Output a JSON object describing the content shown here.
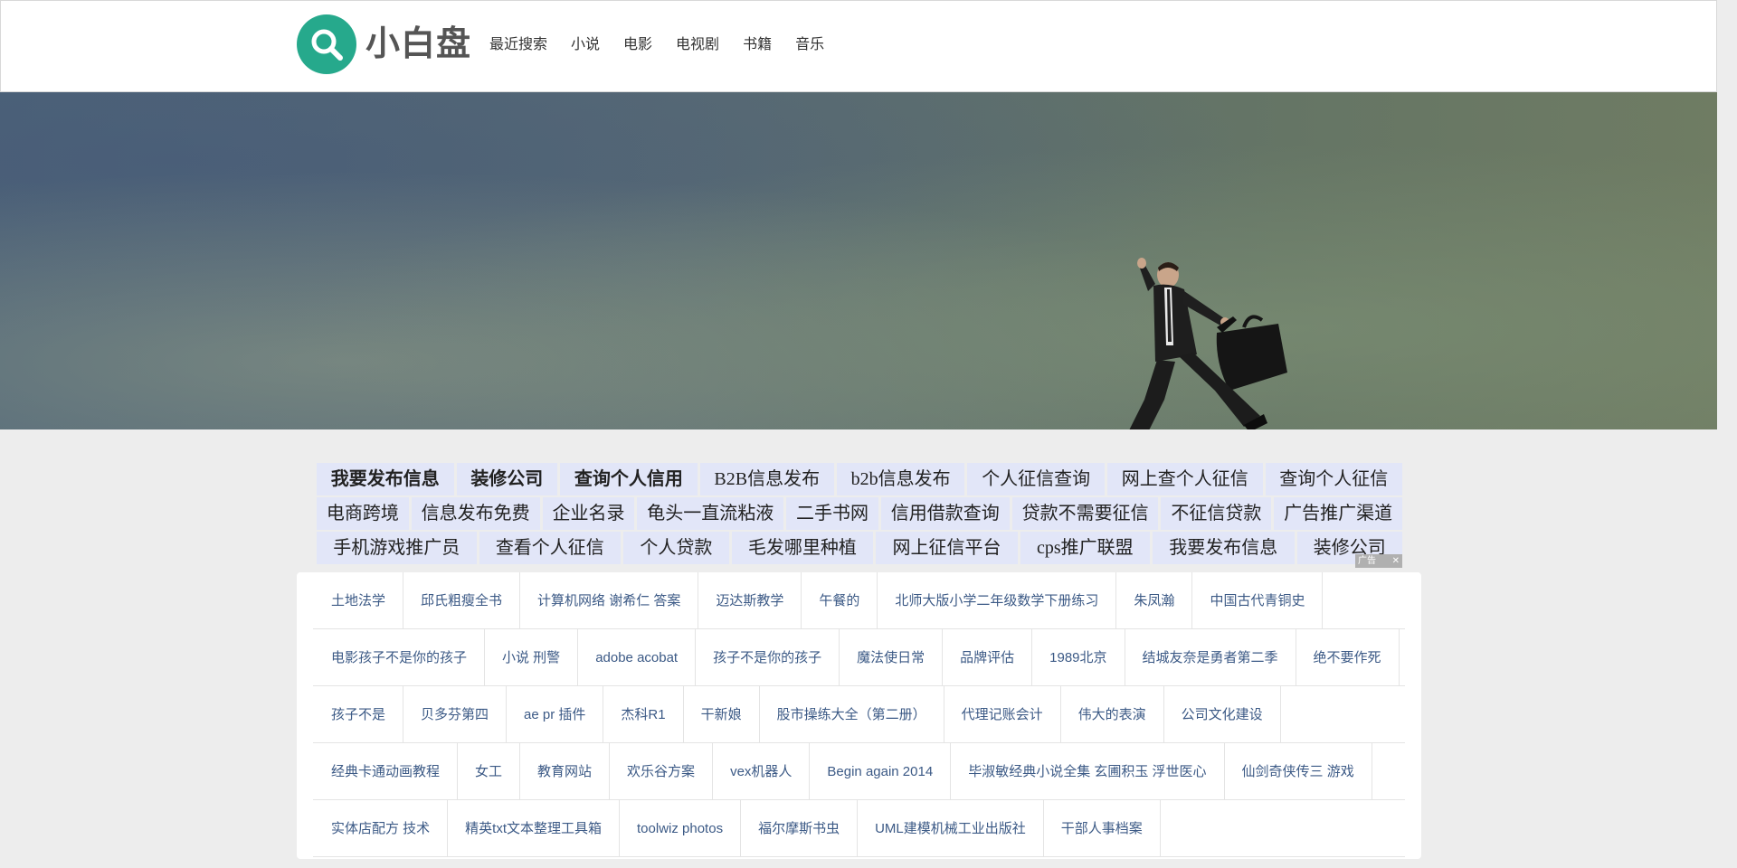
{
  "header": {
    "logo_text": "小白盘",
    "nav": [
      "最近搜索",
      "小说",
      "电影",
      "电视剧",
      "书籍",
      "音乐"
    ]
  },
  "ad": {
    "rows": [
      [
        {
          "text": "我要发布信息",
          "bold": true
        },
        {
          "text": "装修公司",
          "bold": true
        },
        {
          "text": "查询个人信用",
          "bold": true
        },
        {
          "text": "B2B信息发布",
          "bold": false
        },
        {
          "text": "b2b信息发布",
          "bold": false
        },
        {
          "text": "个人征信查询",
          "bold": false
        },
        {
          "text": "网上查个人征信",
          "bold": false
        },
        {
          "text": "查询个人征信",
          "bold": false
        }
      ],
      [
        {
          "text": "电商跨境",
          "bold": false
        },
        {
          "text": "信息发布免费",
          "bold": false
        },
        {
          "text": "企业名录",
          "bold": false
        },
        {
          "text": "龟头一直流粘液",
          "bold": false
        },
        {
          "text": "二手书网",
          "bold": false
        },
        {
          "text": "信用借款查询",
          "bold": false
        },
        {
          "text": "贷款不需要征信",
          "bold": false
        },
        {
          "text": "不征信贷款",
          "bold": false
        },
        {
          "text": "广告推广渠道",
          "bold": false
        }
      ],
      [
        {
          "text": "手机游戏推广员",
          "bold": false
        },
        {
          "text": "查看个人征信",
          "bold": false
        },
        {
          "text": "个人贷款",
          "bold": false
        },
        {
          "text": "毛发哪里种植",
          "bold": false
        },
        {
          "text": "网上征信平台",
          "bold": false
        },
        {
          "text": "cps推广联盟",
          "bold": false
        },
        {
          "text": "我要发布信息",
          "bold": false
        },
        {
          "text": "装修公司",
          "bold": false
        }
      ]
    ],
    "mark_label": "广告"
  },
  "tags": [
    [
      "土地法学",
      "邱氏粗瘦全书",
      "计算机网络 谢希仁 答案",
      "迈达斯教学",
      "午餐的",
      "北师大版小学二年级数学下册练习",
      "朱凤瀚",
      "中国古代青铜史"
    ],
    [
      "电影孩子不是你的孩子",
      "小说 刑警",
      "adobe acobat",
      "孩子不是你的孩子",
      "魔法使日常",
      "品牌评估",
      "1989北京",
      "结城友奈是勇者第二季",
      "绝不要作死"
    ],
    [
      "孩子不是",
      "贝多芬第四",
      "ae pr 插件",
      "杰科R1",
      "干新娘",
      "股市操练大全（第二册）",
      "代理记账会计",
      "伟大的表演",
      "公司文化建设"
    ],
    [
      "经典卡通动画教程",
      "女工",
      "教育网站",
      "欢乐谷方案",
      "vex机器人",
      "Begin again 2014",
      "毕淑敏经典小说全集 玄圃积玉 浮世医心",
      "仙剑奇侠传三 游戏"
    ],
    [
      "实体店配方 技术",
      "精英txt文本整理工具箱",
      "toolwiz photos",
      "福尔摩斯书虫",
      "UML建模机械工业出版社",
      "干部人事档案"
    ]
  ],
  "colors": {
    "logo": "#26a98c",
    "tag_link": "#3c5a86",
    "ad_bg": "#e2e6f8"
  }
}
